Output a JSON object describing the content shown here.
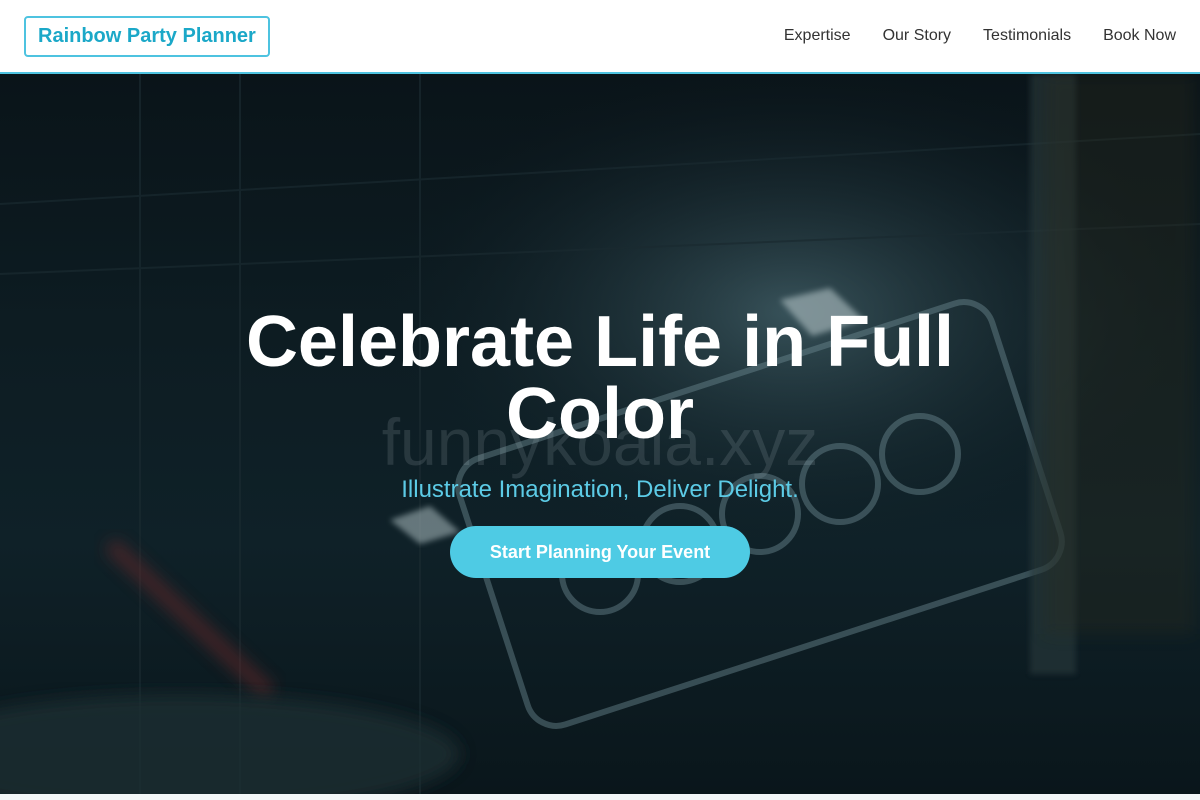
{
  "header": {
    "logo": "Rainbow Party Planner",
    "nav": [
      {
        "label": "Expertise"
      },
      {
        "label": "Our Story"
      },
      {
        "label": "Testimonials"
      },
      {
        "label": "Book Now"
      }
    ]
  },
  "hero": {
    "title": "Celebrate Life in Full Color",
    "subtitle": "Illustrate Imagination, Deliver Delight.",
    "cta_label": "Start Planning Your Event",
    "watermark": "funnykoala.xyz"
  },
  "colors": {
    "accent": "#4ecbe4",
    "logo_text": "#1ba8c8",
    "hero_bg": "#0d1c22",
    "subtitle": "#5ccbe6"
  }
}
